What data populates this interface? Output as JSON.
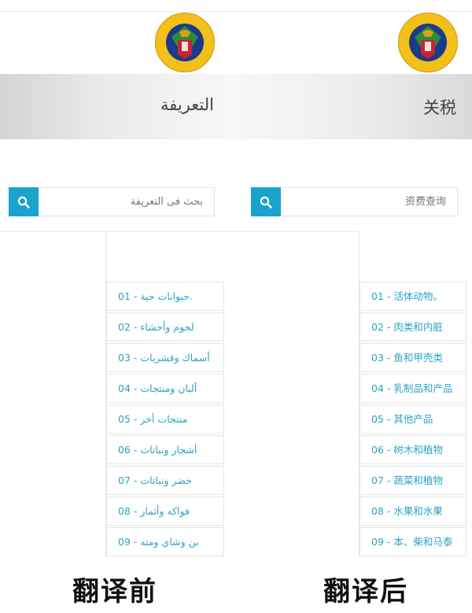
{
  "before": {
    "logo_text": "Egyptian Customs Authority",
    "title": "التعريفة",
    "search_placeholder": "بحث فى التعريفة",
    "chapters": [
      "01 - حيوانات حية.",
      "02 - لحوم وأحشاء",
      "03 - أسماك وقشريات",
      "04 - ألبان ومنتجات",
      "05 - منتجات أخر",
      "06 - أشجار ونباتات",
      "07 - خضر ونباتات",
      "08 - فواكه وأثمار",
      "09 - بن وشاي ومته"
    ],
    "caption": "翻译前"
  },
  "after": {
    "logo_text": "Egyptian Customs Authority",
    "title": "关税",
    "search_placeholder": "资费查询",
    "chapters": [
      "01 - 活体动物。",
      "02 - 肉类和内脏",
      "03 - 鱼和甲壳类",
      "04 - 乳制品和产品",
      "05 - 其他产品",
      "06 - 树木和植物",
      "07 - 蔬菜和植物",
      "08 - 水果和水果",
      "09 - 本、柴和马泰"
    ],
    "caption": "翻译后"
  },
  "colors": {
    "accent": "#1aa4cc",
    "link": "#2ba3c8",
    "logo_gold": "#f2c019"
  },
  "icons": {
    "logo": "eagle-emblem-icon",
    "search": "search-icon"
  }
}
